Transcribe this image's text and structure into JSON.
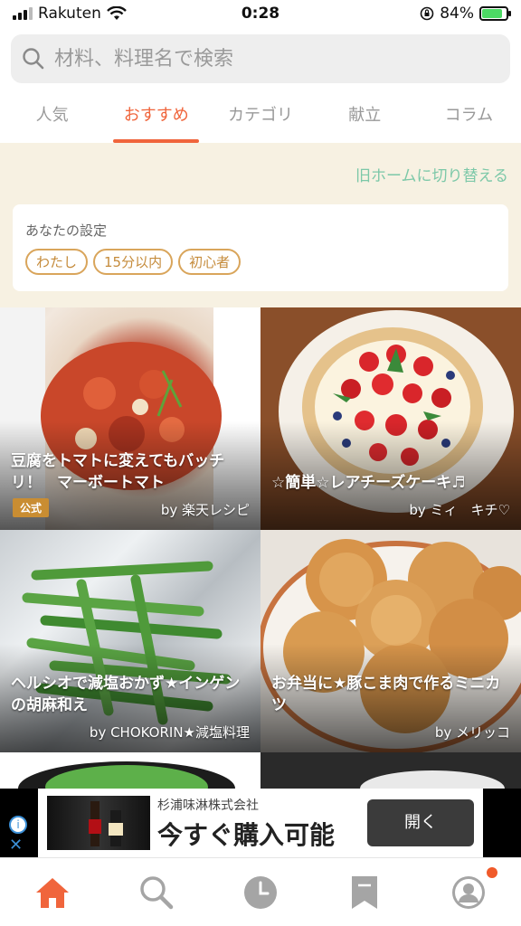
{
  "status_bar": {
    "carrier": "Rakuten",
    "time": "0:28",
    "battery_percent": "84%",
    "battery_level": 0.84
  },
  "search": {
    "placeholder": "材料、料理名で検索"
  },
  "tabs": [
    {
      "label": "人気"
    },
    {
      "label": "おすすめ",
      "active": true
    },
    {
      "label": "カテゴリ"
    },
    {
      "label": "献立"
    },
    {
      "label": "コラム"
    }
  ],
  "switch_home_link": "旧ホームに切り替える",
  "settings": {
    "title": "あなたの設定",
    "chips": [
      "わたし",
      "15分以内",
      "初心者"
    ]
  },
  "recipes": [
    {
      "title": "豆腐をトマトに変えてもバッチリ！　マーボートマト",
      "author": "by 楽天レシピ",
      "badge": "公式"
    },
    {
      "title": "☆簡単☆レアチーズケーキ♬",
      "author": "by ミィ　キチ♡"
    },
    {
      "title": "ヘルシオで減塩おかず★インゲンの胡麻和え",
      "author": "by CHOKORIN★減塩料理"
    },
    {
      "title": "お弁当に★豚こま肉で作るミニカツ",
      "author": "by メリッコ"
    }
  ],
  "ad": {
    "company": "杉浦味淋株式会社",
    "headline": "今すぐ購入可能",
    "button": "開く",
    "info_icon": "i",
    "close_icon": "✕"
  },
  "bottom_nav": [
    {
      "icon": "home-icon",
      "active": true
    },
    {
      "icon": "search-icon"
    },
    {
      "icon": "history-icon"
    },
    {
      "icon": "bookmark-icon"
    },
    {
      "icon": "profile-icon",
      "badge": true
    }
  ],
  "colors": {
    "accent": "#f0653c",
    "link_green": "#7cc8a8",
    "chip_border": "#d9a55b",
    "beige_bg": "#f7f1e2",
    "inactive_icon": "#a5a5a5"
  }
}
